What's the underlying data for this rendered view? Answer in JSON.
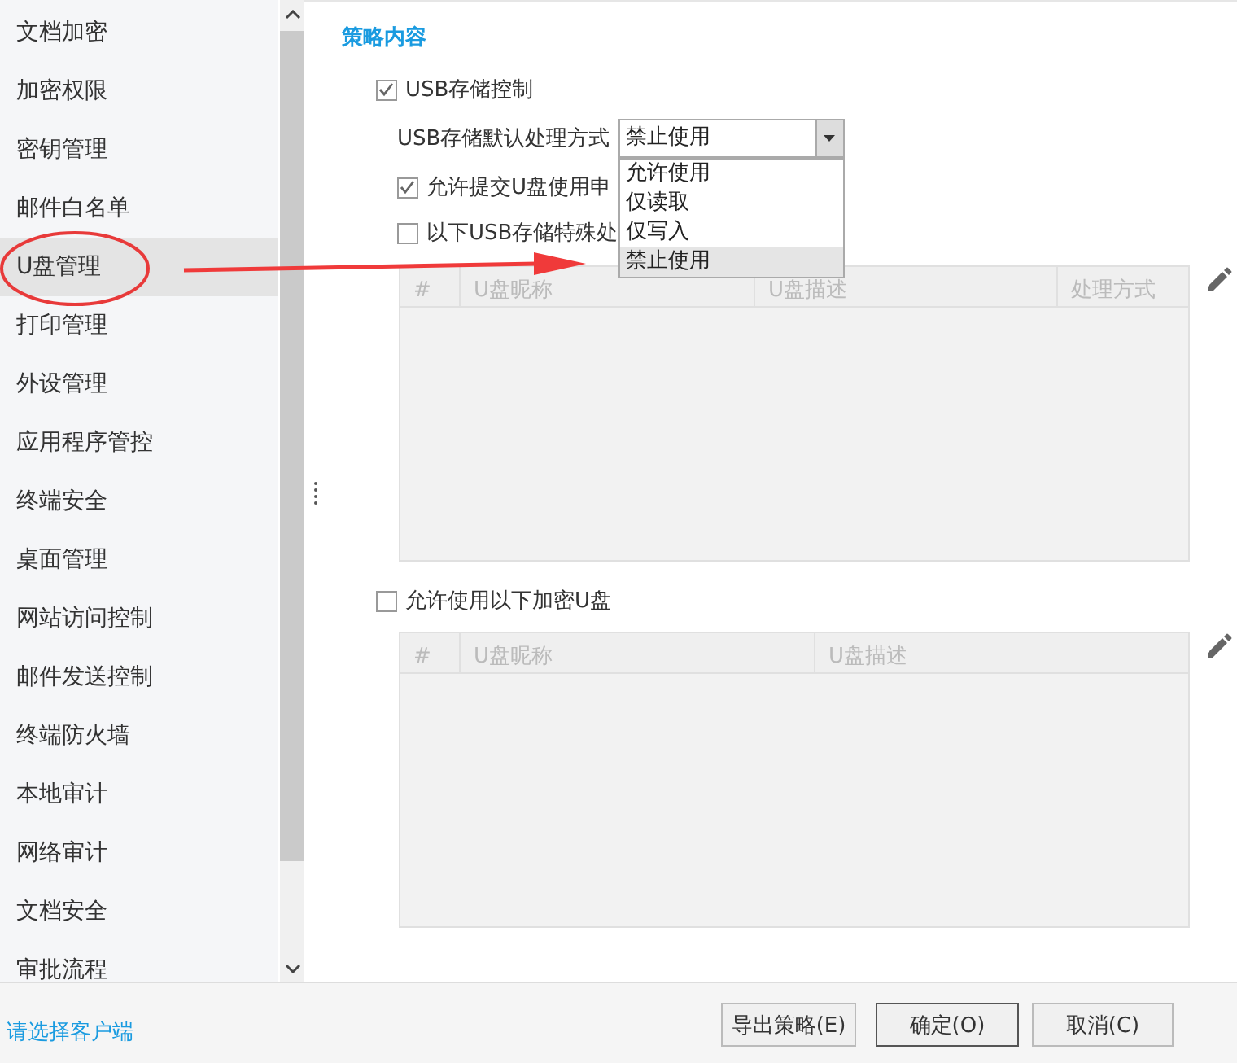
{
  "sidebar": {
    "items": [
      {
        "label": "文档加密",
        "selected": false
      },
      {
        "label": "加密权限",
        "selected": false
      },
      {
        "label": "密钥管理",
        "selected": false
      },
      {
        "label": "邮件白名单",
        "selected": false
      },
      {
        "label": "U盘管理",
        "selected": true
      },
      {
        "label": "打印管理",
        "selected": false
      },
      {
        "label": "外设管理",
        "selected": false
      },
      {
        "label": "应用程序管控",
        "selected": false
      },
      {
        "label": "终端安全",
        "selected": false
      },
      {
        "label": "桌面管理",
        "selected": false
      },
      {
        "label": "网站访问控制",
        "selected": false
      },
      {
        "label": "邮件发送控制",
        "selected": false
      },
      {
        "label": "终端防火墙",
        "selected": false
      },
      {
        "label": "本地审计",
        "selected": false
      },
      {
        "label": "网络审计",
        "selected": false
      },
      {
        "label": "文档安全",
        "selected": false
      },
      {
        "label": "审批流程",
        "selected": false
      }
    ]
  },
  "content": {
    "title": "策略内容",
    "usb_control": {
      "label": "USB存储控制",
      "checked": true
    },
    "default_mode": {
      "label": "USB存储默认处理方式",
      "value": "禁止使用",
      "expanded": true,
      "options": [
        {
          "label": "允许使用",
          "selected": false
        },
        {
          "label": "仅读取",
          "selected": false
        },
        {
          "label": "仅写入",
          "selected": false
        },
        {
          "label": "禁止使用",
          "selected": true
        }
      ]
    },
    "allow_request": {
      "label": "允许提交U盘使用申",
      "checked": true
    },
    "special": {
      "label": "以下USB存储特殊处",
      "checked": false
    },
    "table_1": {
      "columns": [
        "#",
        "U盘昵称",
        "U盘描述",
        "处理方式"
      ]
    },
    "allow_encrypted": {
      "label": "允许使用以下加密U盘",
      "checked": false
    },
    "table_2": {
      "columns": [
        "#",
        "U盘昵称",
        "U盘描述"
      ]
    }
  },
  "footer": {
    "link": "请选择客户端",
    "buttons": [
      "导出策略(E)",
      "确定(O)",
      "取消(C)"
    ]
  }
}
